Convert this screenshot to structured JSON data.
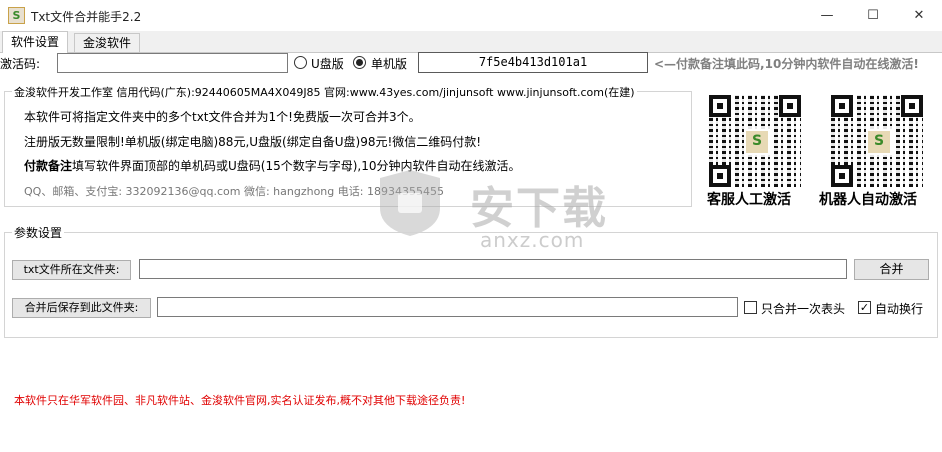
{
  "window": {
    "title": "Txt文件合并能手2.2",
    "minimize_glyph": "—",
    "maximize_glyph": "☐",
    "close_glyph": "✕"
  },
  "tabs": [
    {
      "label": "软件设置",
      "active": true
    },
    {
      "label": "金浚软件",
      "active": false
    }
  ],
  "activation": {
    "label": "激活码:",
    "value": "",
    "options": [
      {
        "label": "U盘版",
        "selected": false
      },
      {
        "label": "单机版",
        "selected": true
      }
    ],
    "machine_code": "7f5e4b413d101a1",
    "hint": "<—付款备注填此码,10分钟内软件自动在线激活!",
    "hint_color": "#808080"
  },
  "info": {
    "heading": "金浚软件开发工作室 信用代码(广东):92440605MA4X049J85 官网:www.43yes.com/jinjunsoft  www.jinjunsoft.com(在建)",
    "line1": "本软件可将指定文件夹中的多个txt文件合并为1个!免费版一次可合并3个。",
    "line2": "注册版无数量限制!单机版(绑定电脑)88元,U盘版(绑定自备U盘)98元!微信二维码付款!",
    "line3_bold": "付款备注",
    "line3": "填写软件界面顶部的单机码或U盘码(15个数字与字母),10分钟内软件自动在线激活。",
    "contact": "QQ、邮箱、支付宝: 332092136@qq.com   微信: hangzhong   电话: 18934355455",
    "contact_color": "#777777"
  },
  "qr_codes": [
    {
      "caption": "客服人工激活",
      "icon": "qr-code-icon"
    },
    {
      "caption": "机器人自动激活",
      "icon": "qr-code-icon"
    }
  ],
  "params": {
    "group_title": "参数设置",
    "source_label": "txt文件所在文件夹:",
    "source_value": "",
    "merge_button": "合并",
    "target_label": "合并后保存到此文件夹:",
    "target_value": "",
    "header_once": {
      "label": "只合并一次表头",
      "checked": false
    },
    "auto_wrap": {
      "label": "自动换行",
      "checked": true
    }
  },
  "footer": {
    "notice": "本软件只在华军软件园、非凡软件站、金浚软件官网,实名认证发布,概不对其他下载途径负责!",
    "color": "#e00000"
  },
  "watermark": {
    "text": "安下载",
    "sub": "anxz.com"
  }
}
